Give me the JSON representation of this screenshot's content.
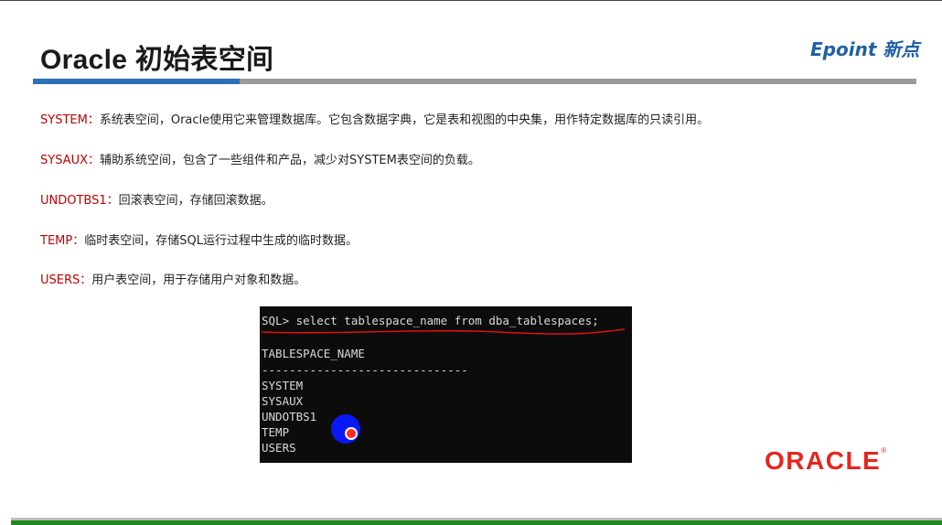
{
  "title": "Oracle 初始表空间",
  "brand": {
    "logo_text": "Epoint 新点"
  },
  "items": [
    {
      "term": "SYSTEM",
      "desc": "系统表空间，Oracle使用它来管理数据库。它包含数据字典，它是表和视图的中央集，用作特定数据库的只读引用。"
    },
    {
      "term": "SYSAUX",
      "desc": "辅助系统空间，包含了一些组件和产品，减少对SYSTEM表空间的负载。"
    },
    {
      "term": "UNDOTBS1",
      "desc": "回滚表空间，存储回滚数据。"
    },
    {
      "term": "TEMP",
      "desc": "临时表空间，存储SQL运行过程中生成的临时数据。"
    },
    {
      "term": "USERS",
      "desc": "用户表空间，用于存储用户对象和数据。"
    }
  ],
  "colon": "：",
  "terminal": {
    "command": "SQL> select tablespace_name from dba_tablespaces;",
    "header": "TABLESPACE_NAME",
    "separator": "------------------------------",
    "rows": [
      "SYSTEM",
      "SYSAUX",
      "UNDOTBS1",
      "TEMP",
      "USERS"
    ]
  },
  "oracle_logo": {
    "text": "ORACLE",
    "mark": "®"
  },
  "colors": {
    "accent_red": "#c00000",
    "title_rule_blue": "#2f6fb4",
    "footer_green": "#1e8a1e",
    "oracle_red": "#e8251e"
  }
}
